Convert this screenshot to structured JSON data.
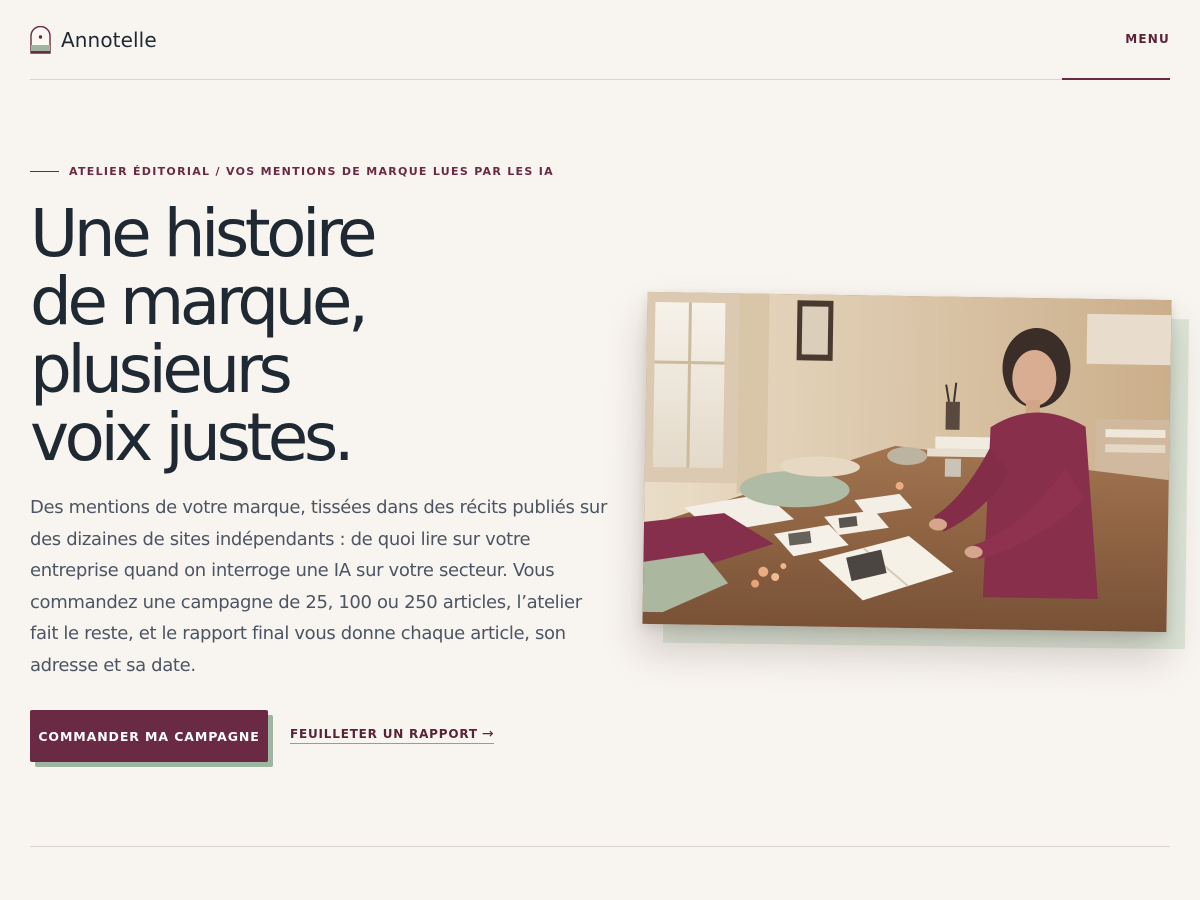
{
  "header": {
    "brand_name": "Annotelle",
    "logo_icon": "arch-window-icon",
    "menu_label": "MENU"
  },
  "hero": {
    "eyebrow": "ATELIER ÉDITORIAL / VOS MENTIONS DE MARQUE LUES PAR LES IA",
    "title_lines": [
      "Une histoire",
      "de marque,",
      "plusieurs",
      "voix justes."
    ],
    "lede": "Des mentions de votre marque, tissées dans des récits publiés sur des dizaines de sites indépendants : de quoi lire sur votre entreprise quand on interroge une IA sur votre secteur. Vous commandez une campagne de 25, 100 ou 250 articles, l’atelier fait le reste, et le rapport final vous donne chaque article, son adresse et sa date.",
    "primary_cta": "COMMANDER MA CAMPAGNE",
    "secondary_cta": "FEUILLETER UN RAPPORT",
    "secondary_cta_icon": "arrow-right-icon",
    "image_subject": "woman working at a wooden table covered with fabric swatches, photos and an open book"
  },
  "colors": {
    "background": "#f8f4ef",
    "accent": "#6b2a44",
    "sage": "#9db5a1",
    "text": "#1f2933",
    "muted_text": "#4b5563"
  }
}
